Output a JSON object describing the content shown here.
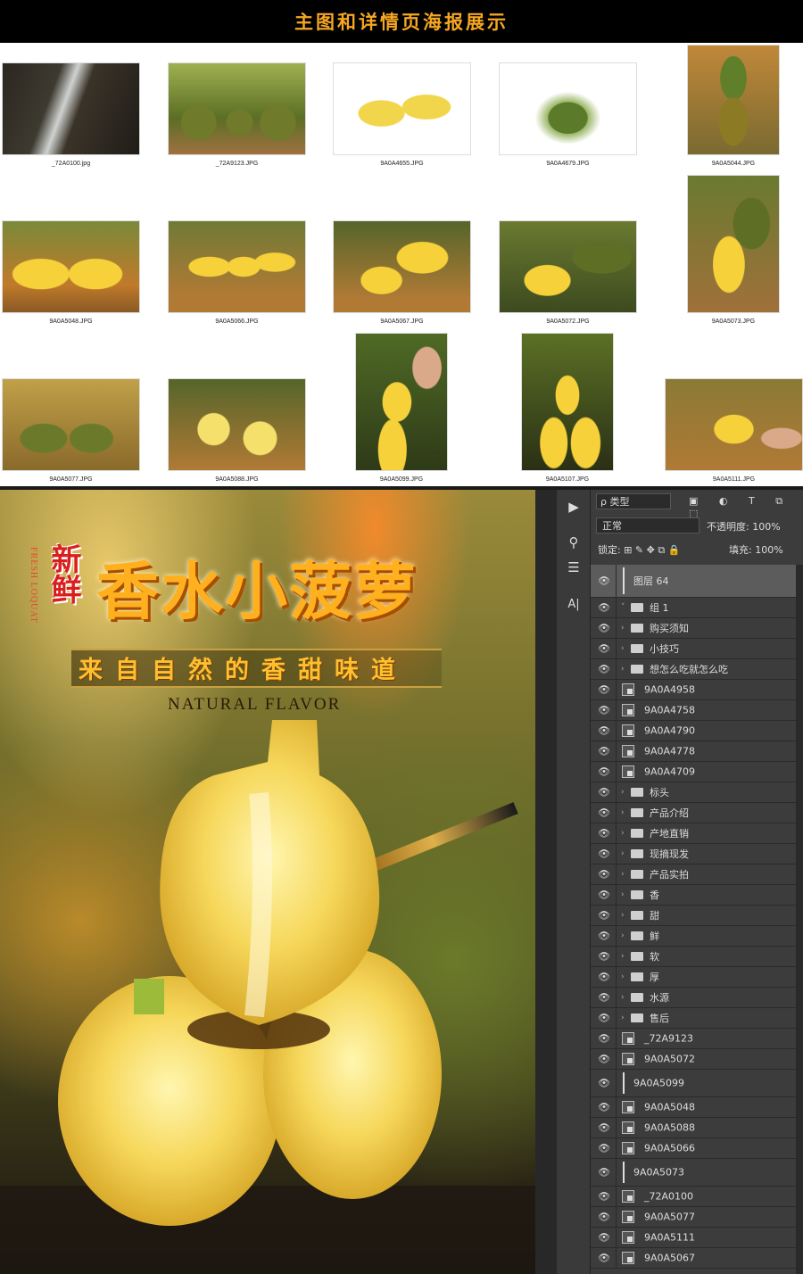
{
  "header": {
    "title": "主图和详情页海报展示"
  },
  "gallery": {
    "files": [
      "_72A0100.jpg",
      "_72A9123.JPG",
      "9A0A4655.JPG",
      "9A0A4679.JPG",
      "9A0A5044.JPG",
      "9A0A5048.JPG",
      "9A0A5066.JPG",
      "9A0A5067.JPG",
      "9A0A5072.JPG",
      "9A0A5073.JPG",
      "9A0A5077.JPG",
      "9A0A5088.JPG",
      "9A0A5099.JPG",
      "9A0A5107.JPG",
      "9A0A5111.JPG"
    ]
  },
  "poster": {
    "badge": "新鲜",
    "vertical_text": "FRESH LOQUAT",
    "title": "香水小菠萝",
    "subtitle": "来自自然的香甜味道",
    "english": "NATURAL FLAVOR"
  },
  "ps": {
    "filter_label": "ρ 类型",
    "filter_icons": "▣ ◐ T ⧉ ⬚",
    "blend_mode": "正常",
    "opacity_label": "不透明度: 100%",
    "lock_label": "锁定: ⊞ ✎ ✥ ⧉ 🔒",
    "fill_label": "填充: 100%",
    "tools": [
      "▶",
      "⚲",
      "☰",
      "A|"
    ],
    "layers": [
      {
        "name": "图层 64",
        "kind": "selected"
      },
      {
        "name": "组 1",
        "kind": "group-open"
      },
      {
        "name": "购买须知",
        "kind": "group"
      },
      {
        "name": "小技巧",
        "kind": "group"
      },
      {
        "name": "想怎么吃就怎么吃",
        "kind": "group"
      },
      {
        "name": "9A0A4958",
        "kind": "smart"
      },
      {
        "name": "9A0A4758",
        "kind": "smart"
      },
      {
        "name": "9A0A4790",
        "kind": "smart"
      },
      {
        "name": "9A0A4778",
        "kind": "smart"
      },
      {
        "name": "9A0A4709",
        "kind": "smart"
      },
      {
        "name": "标头",
        "kind": "group"
      },
      {
        "name": "产品介绍",
        "kind": "group"
      },
      {
        "name": "产地直销",
        "kind": "group"
      },
      {
        "name": "现摘现发",
        "kind": "group"
      },
      {
        "name": "产品实拍",
        "kind": "group"
      },
      {
        "name": "香",
        "kind": "group"
      },
      {
        "name": "甜",
        "kind": "group"
      },
      {
        "name": "鲜",
        "kind": "group"
      },
      {
        "name": "软",
        "kind": "group"
      },
      {
        "name": "厚",
        "kind": "group"
      },
      {
        "name": "水源",
        "kind": "group"
      },
      {
        "name": "售后",
        "kind": "group"
      },
      {
        "name": "_72A9123",
        "kind": "smart"
      },
      {
        "name": "9A0A5072",
        "kind": "smart"
      },
      {
        "name": "9A0A5099",
        "kind": "thin"
      },
      {
        "name": "9A0A5048",
        "kind": "smart"
      },
      {
        "name": "9A0A5088",
        "kind": "smart"
      },
      {
        "name": "9A0A5066",
        "kind": "smart"
      },
      {
        "name": "9A0A5073",
        "kind": "thin"
      },
      {
        "name": "_72A0100",
        "kind": "smart"
      },
      {
        "name": "9A0A5077",
        "kind": "smart"
      },
      {
        "name": "9A0A5111",
        "kind": "smart"
      },
      {
        "name": "9A0A5067",
        "kind": "smart"
      }
    ]
  }
}
